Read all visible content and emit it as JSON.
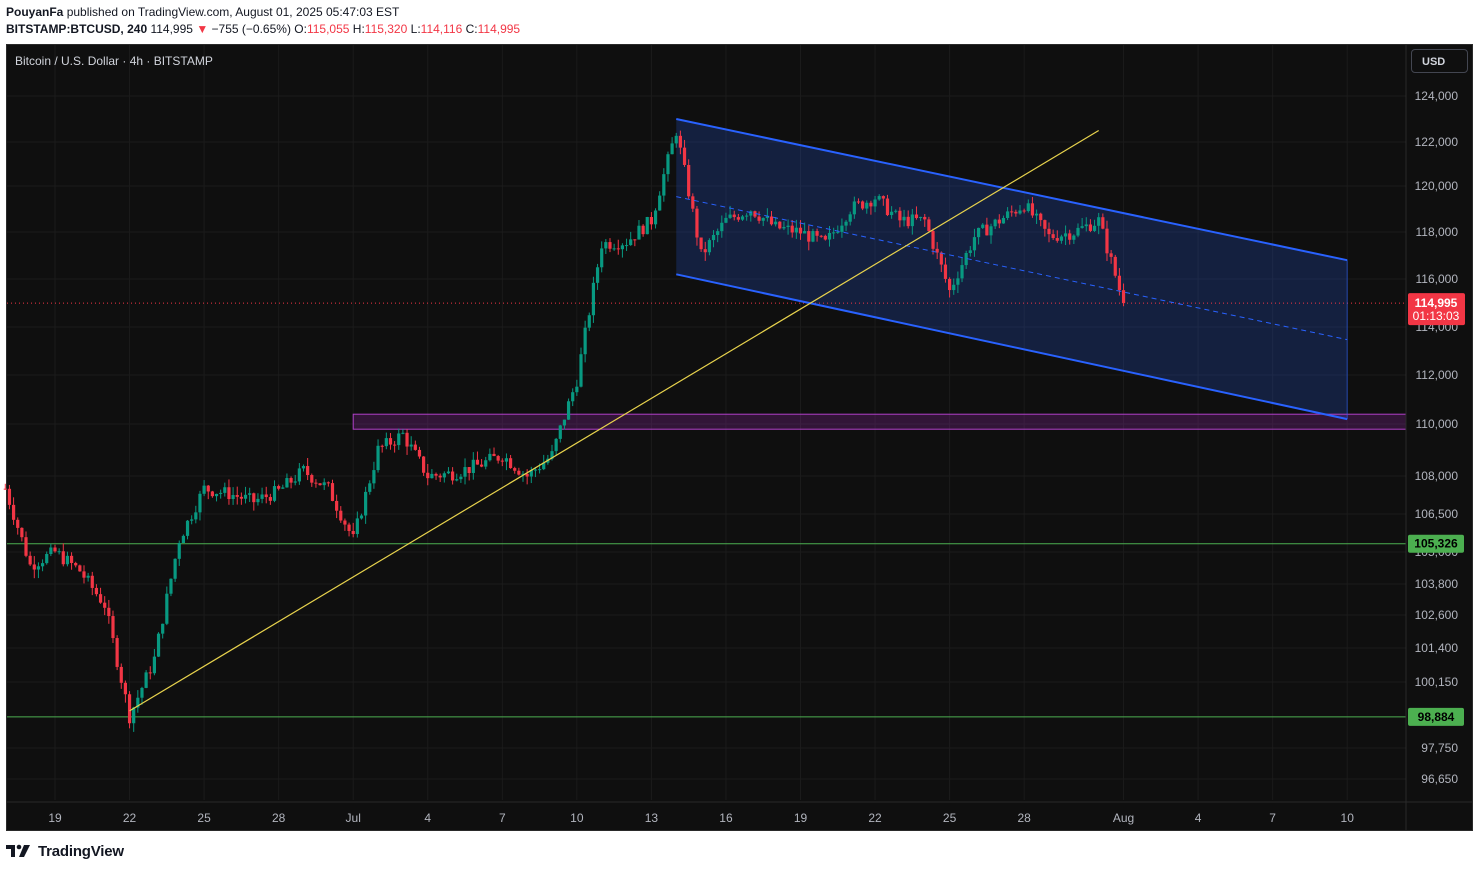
{
  "header": {
    "author": "PouyanFa",
    "published": "published on TradingView.com, August 01, 2025 05:47:03 EST",
    "symbol": "BITSTAMP:BTCUSD, 240",
    "last": "114,995",
    "arrow": "▼",
    "change": "−755 (−0.65%)",
    "open_label": "O:",
    "open": "115,055",
    "high_label": "H:",
    "high": "115,320",
    "low_label": "L:",
    "low": "114,116",
    "close_label": "C:",
    "close": "114,995"
  },
  "chart_title": "Bitcoin / U.S. Dollar · 4h · BITSTAMP",
  "currency_button": "USD",
  "footer": {
    "brand": "TradingView",
    "logo_icon": "tradingview-logo-icon"
  },
  "colors": {
    "up": "#089981",
    "down": "#f23645",
    "background": "#0f0f0f",
    "channel": "#2962ff",
    "trendline": "#e8d34d",
    "zone": "#9c27b0",
    "support": "#4caf50"
  },
  "chart_data": {
    "type": "candlestick",
    "timeframe": "4h",
    "x_tick_labels": [
      "19",
      "22",
      "25",
      "28",
      "Jul",
      "4",
      "7",
      "10",
      "13",
      "16",
      "19",
      "22",
      "25",
      "28",
      "Aug",
      "4",
      "7",
      "10"
    ],
    "y_tick_labels": [
      "124,000",
      "122,000",
      "120,000",
      "118,000",
      "116,000",
      "114,000",
      "112,000",
      "110,000",
      "108,000",
      "106,500",
      "105,000",
      "103,800",
      "102,600",
      "101,400",
      "100,150",
      "97,750",
      "96,650"
    ],
    "y_range": [
      96000,
      125000
    ],
    "current_price": {
      "value": 114995,
      "label": "114,995",
      "countdown": "01:13:03"
    },
    "horizontal_levels": [
      {
        "value": 105326,
        "label": "105,326"
      },
      {
        "value": 98884,
        "label": "98,884"
      }
    ],
    "zone": {
      "from": 109800,
      "to": 110400,
      "start": "Jul 1"
    },
    "trendline": {
      "from": {
        "date": "Jun 22",
        "price": 99100
      },
      "to": {
        "date": "Jul 31",
        "price": 122500
      }
    },
    "channel": {
      "upper": [
        {
          "date": "Jul 14",
          "price": 123000
        },
        {
          "date": "Aug 10",
          "price": 116800
        }
      ],
      "lower": [
        {
          "date": "Jul 14",
          "price": 116200
        },
        {
          "date": "Aug 10",
          "price": 110200
        }
      ]
    },
    "ohlc_keypoints": [
      [
        "Jun 17",
        107500
      ],
      [
        "Jun 18",
        104500
      ],
      [
        "Jun 19",
        105000
      ],
      [
        "Jun 20",
        104300
      ],
      [
        "Jun 21",
        103000
      ],
      [
        "Jun 22",
        98900
      ],
      [
        "Jun 23",
        101000
      ],
      [
        "Jun 24",
        105500
      ],
      [
        "Jun 25",
        107500
      ],
      [
        "Jun 26",
        107300
      ],
      [
        "Jun 27",
        107000
      ],
      [
        "Jun 28",
        107400
      ],
      [
        "Jun 29",
        108200
      ],
      [
        "Jun 30",
        107500
      ],
      [
        "Jul 1",
        105500
      ],
      [
        "Jul 2",
        109000
      ],
      [
        "Jul 3",
        109600
      ],
      [
        "Jul 4",
        108000
      ],
      [
        "Jul 5",
        108100
      ],
      [
        "Jul 6",
        108400
      ],
      [
        "Jul 7",
        108800
      ],
      [
        "Jul 8",
        108000
      ],
      [
        "Jul 9",
        108800
      ],
      [
        "Jul 10",
        111800
      ],
      [
        "Jul 11",
        117500
      ],
      [
        "Jul 12",
        117600
      ],
      [
        "Jul 13",
        118500
      ],
      [
        "Jul 14",
        122500
      ],
      [
        "Jul 15",
        117000
      ],
      [
        "Jul 16",
        118500
      ],
      [
        "Jul 17",
        119000
      ],
      [
        "Jul 18",
        118200
      ],
      [
        "Jul 19",
        118000
      ],
      [
        "Jul 20",
        117500
      ],
      [
        "Jul 21",
        119000
      ],
      [
        "Jul 22",
        119500
      ],
      [
        "Jul 23",
        118500
      ],
      [
        "Jul 24",
        118500
      ],
      [
        "Jul 25",
        115500
      ],
      [
        "Jul 26",
        117800
      ],
      [
        "Jul 27",
        118500
      ],
      [
        "Jul 28",
        119200
      ],
      [
        "Jul 29",
        117800
      ],
      [
        "Jul 30",
        118000
      ],
      [
        "Jul 31",
        118500
      ],
      [
        "Aug 1",
        114995
      ]
    ]
  }
}
